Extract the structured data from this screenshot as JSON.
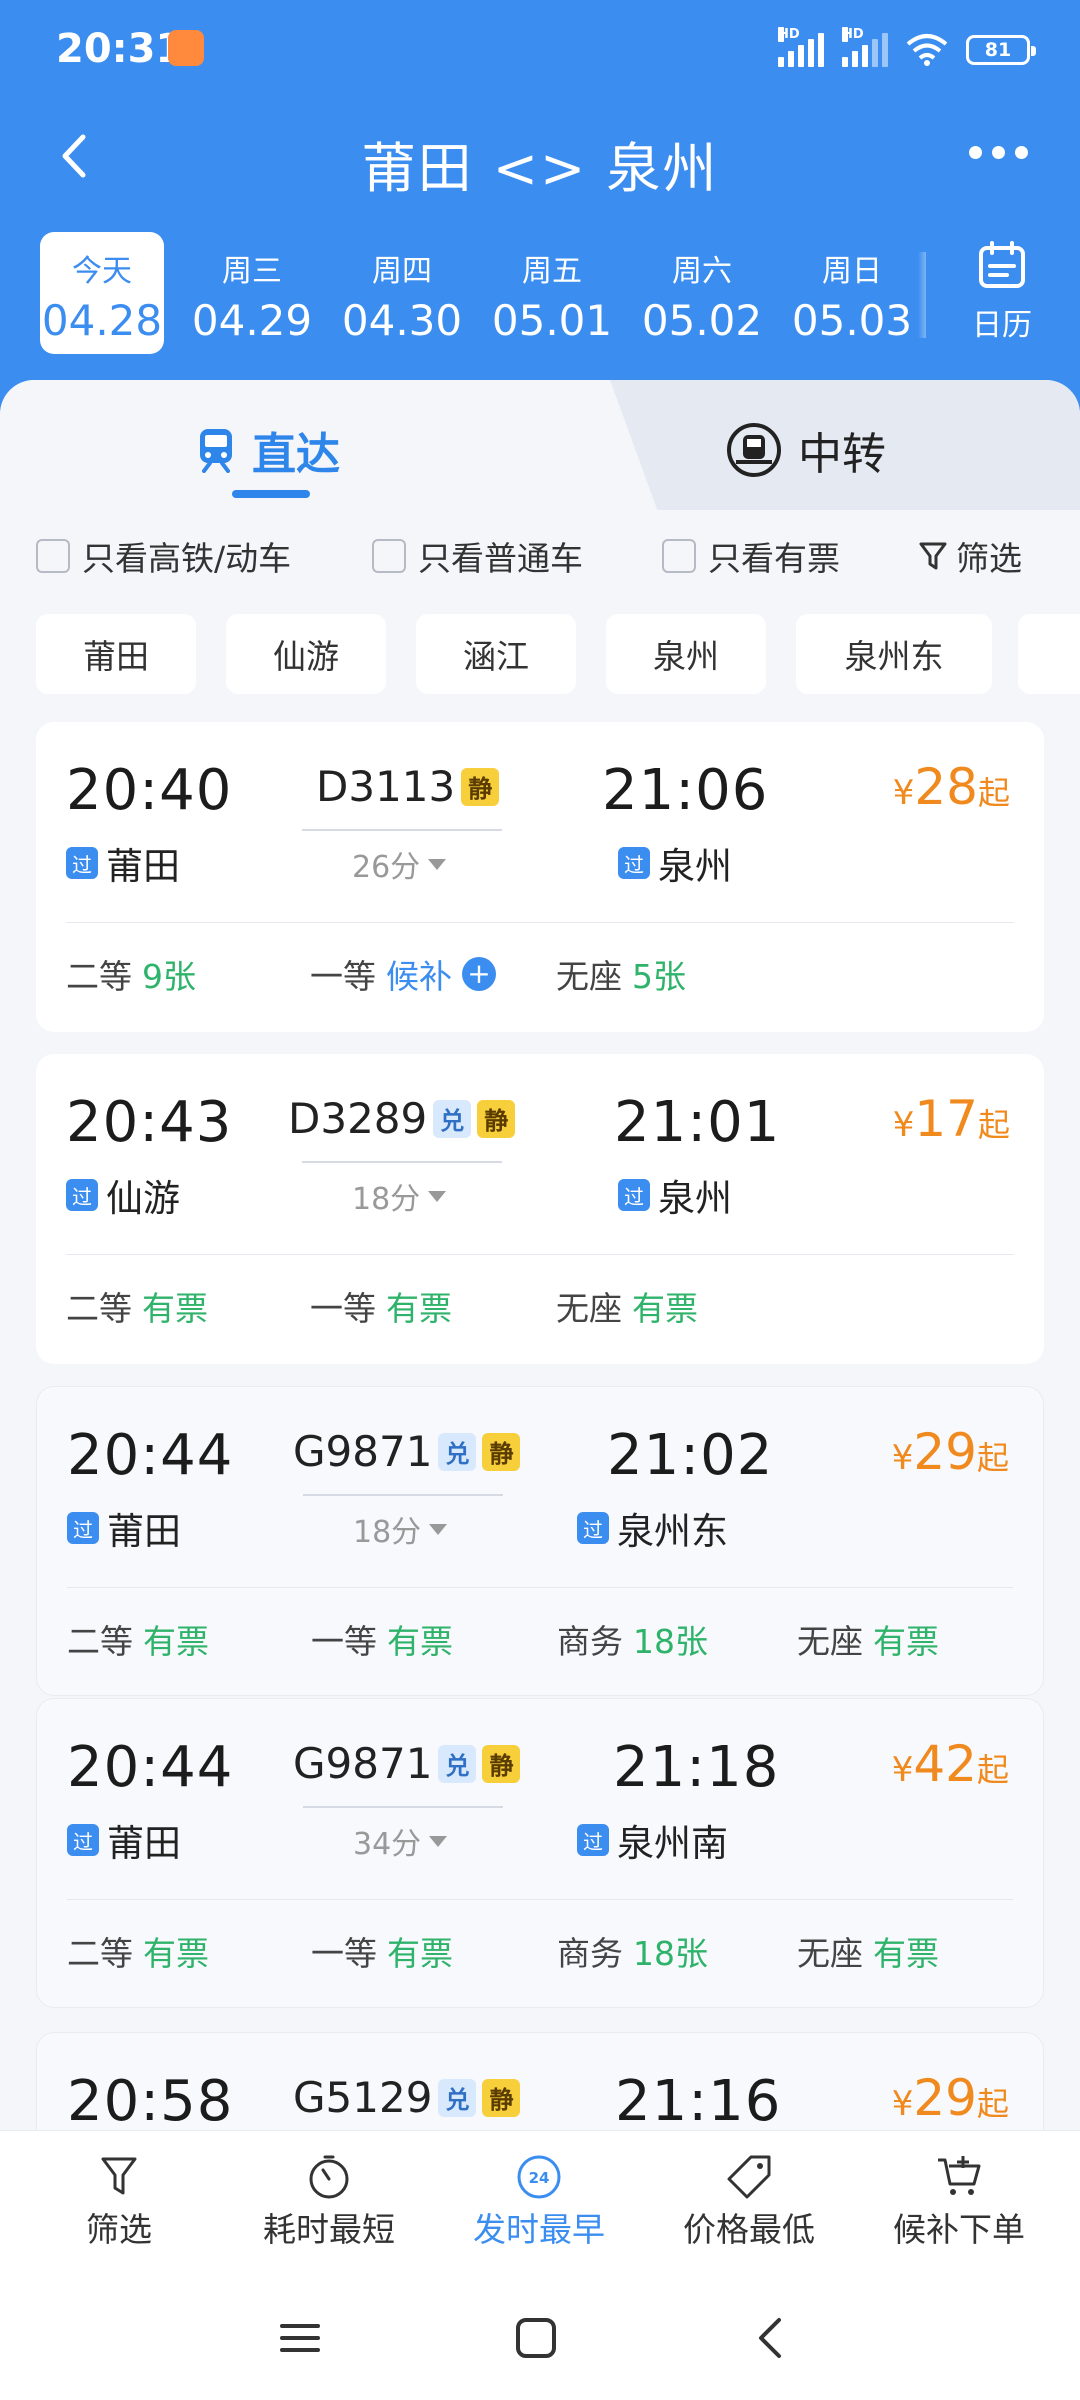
{
  "status": {
    "time": "20:31",
    "hd1": "HD",
    "hd2": "HD",
    "battery": "81"
  },
  "header": {
    "title": "莆田 <> 泉州"
  },
  "dates": [
    {
      "weekday": "今天",
      "date": "04.28",
      "active": true
    },
    {
      "weekday": "周三",
      "date": "04.29"
    },
    {
      "weekday": "周四",
      "date": "04.30"
    },
    {
      "weekday": "周五",
      "date": "05.01"
    },
    {
      "weekday": "周六",
      "date": "05.02"
    },
    {
      "weekday": "周日",
      "date": "05.03"
    }
  ],
  "calendar_label": "日历",
  "tabs": {
    "direct": "直达",
    "transfer": "中转"
  },
  "filters": {
    "high_speed": "只看高铁/动车",
    "ordinary": "只看普通车",
    "available": "只看有票",
    "filter": "筛选"
  },
  "stations": [
    "莆田",
    "仙游",
    "涵江",
    "泉州",
    "泉州东"
  ],
  "trains": [
    {
      "dep_time": "20:40",
      "dep_station": "莆田",
      "pass_tag": "过",
      "train_no": "D3113",
      "tags": [
        "静"
      ],
      "duration": "26分",
      "arr_time": "21:06",
      "arr_station": "泉州",
      "price_symbol": "¥",
      "price": "28",
      "price_suffix": "起",
      "seats": [
        {
          "class": "二等",
          "value": "9张"
        },
        {
          "class": "一等",
          "value": "候补"
        },
        {
          "class": "无座",
          "value": "5张"
        }
      ]
    },
    {
      "dep_time": "20:43",
      "dep_station": "仙游",
      "pass_tag": "过",
      "train_no": "D3289",
      "tags": [
        "兑",
        "静"
      ],
      "duration": "18分",
      "arr_time": "21:01",
      "arr_station": "泉州",
      "price_symbol": "¥",
      "price": "17",
      "price_suffix": "起",
      "seats": [
        {
          "class": "二等",
          "value": "有票"
        },
        {
          "class": "一等",
          "value": "有票"
        },
        {
          "class": "无座",
          "value": "有票"
        }
      ]
    },
    {
      "dep_time": "20:44",
      "dep_station": "莆田",
      "pass_tag": "过",
      "train_no": "G9871",
      "tags": [
        "兑",
        "静"
      ],
      "duration": "18分",
      "arr_time": "21:02",
      "arr_station": "泉州东",
      "price_symbol": "¥",
      "price": "29",
      "price_suffix": "起",
      "seats": [
        {
          "class": "二等",
          "value": "有票"
        },
        {
          "class": "一等",
          "value": "有票"
        },
        {
          "class": "商务",
          "value": "18张"
        },
        {
          "class": "无座",
          "value": "有票"
        }
      ]
    },
    {
      "dep_time": "20:44",
      "dep_station": "莆田",
      "pass_tag": "过",
      "train_no": "G9871",
      "tags": [
        "兑",
        "静"
      ],
      "duration": "34分",
      "arr_time": "21:18",
      "arr_station": "泉州南",
      "price_symbol": "¥",
      "price": "42",
      "price_suffix": "起",
      "seats": [
        {
          "class": "二等",
          "value": "有票"
        },
        {
          "class": "一等",
          "value": "有票"
        },
        {
          "class": "商务",
          "value": "18张"
        },
        {
          "class": "无座",
          "value": "有票"
        }
      ]
    },
    {
      "dep_time": "20:58",
      "train_no": "G5129",
      "tags": [
        "兑",
        "静"
      ],
      "arr_time": "21:16",
      "price_symbol": "¥",
      "price": "29",
      "price_suffix": "起"
    }
  ],
  "sortbar": {
    "filter": "筛选",
    "shortest": "耗时最短",
    "earliest": "发时最早",
    "earliest_badge": "24",
    "cheapest": "价格最低",
    "waitlist": "候补下单"
  },
  "colors": {
    "primary": "#3b8df0",
    "price": "#f08a1e",
    "available": "#2fb36a"
  }
}
